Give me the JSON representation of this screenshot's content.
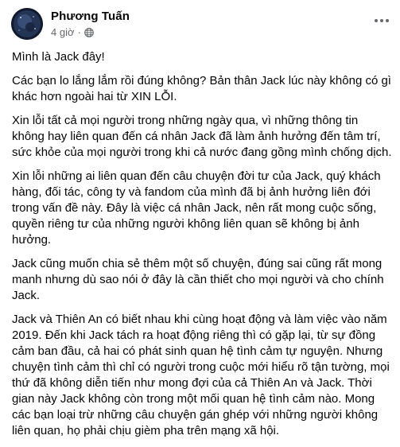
{
  "post": {
    "author_name": "Phương Tuấn",
    "time": "4 giờ",
    "separator": "·",
    "privacy_icon": "globe-icon",
    "more_icon": "more-options-icon",
    "paragraphs": [
      "Mình là Jack đây!",
      "Các bạn lo lắng lắm rồi đúng không? Bản thân Jack lúc này không có gì khác hơn ngoài hai từ XIN LỖI.",
      "Xin lỗi tất cả mọi người trong những ngày qua, vì những thông tin không hay liên quan đến cá nhân Jack đã làm ảnh hưởng đến tâm trí, sức khỏe của mọi người trong khi cả nước đang gồng mình chống dịch.",
      "Xin lỗi những ai liên quan đến câu chuyện đời tư của Jack, quý khách hàng, đối tác, công ty và fandom của mình đã bị ảnh hưởng liên đới trong vấn đề này. Đây là việc cá nhân Jack, nên rất mong cuộc sống, quyền riêng tư của những người không liên quan sẽ không bị ảnh hưởng.",
      "Jack cũng muốn chia sẻ thêm một số chuyện, đúng sai cũng rất mong manh nhưng dù sao nói ở đây là cần thiết cho mọi người và cho chính Jack.",
      "Jack và Thiên An có biết nhau khi cùng hoạt động và làm việc vào năm 2019. Đến khi Jack tách ra hoạt động riêng thì có gặp lại, từ sự đồng cảm ban đầu, cả hai có phát sinh quan hệ tình cảm tự nguyện. Nhưng chuyện tình cảm thì chỉ có người trong cuộc mới hiểu rõ tận tường, mọi thứ đã không diễn tiến như mong đợi của cả Thiên An và Jack. Thời gian này Jack không còn trong một mối quan hệ tình cảm nào. Mong các bạn loại trừ những câu chuyện gán ghép với những người không liên quan, họ phải chịu gièm pha trên mạng xã hội."
    ]
  },
  "colors": {
    "text_primary": "#050505",
    "text_secondary": "#65676b",
    "background": "#ffffff"
  }
}
